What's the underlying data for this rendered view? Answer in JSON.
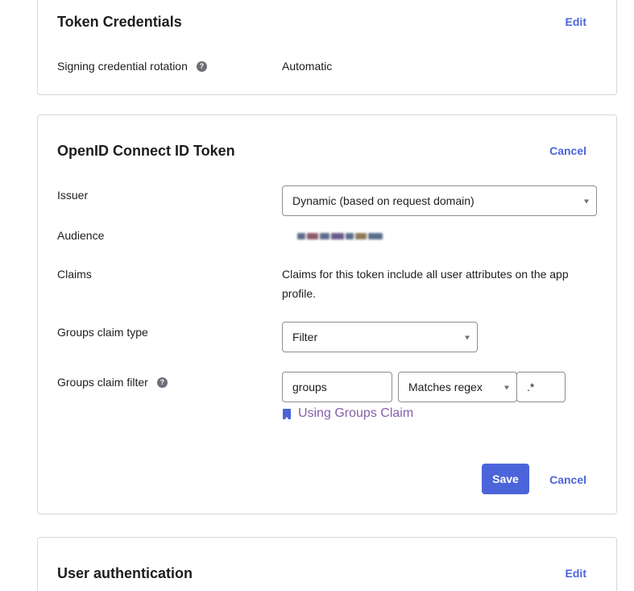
{
  "token_credentials": {
    "title": "Token Credentials",
    "edit_label": "Edit",
    "rotation_label": "Signing credential rotation",
    "rotation_value": "Automatic"
  },
  "oidc_token": {
    "title": "OpenID Connect ID Token",
    "cancel_label": "Cancel",
    "issuer_label": "Issuer",
    "issuer_value": "Dynamic (based on request domain)",
    "audience_label": "Audience",
    "claims_label": "Claims",
    "claims_line1": "Claims for this token include all user attributes on the app",
    "claims_line2": "profile.",
    "groups_claim_type_label": "Groups claim type",
    "groups_claim_type_value": "Filter",
    "groups_claim_filter_label": "Groups claim filter",
    "filter_name_value": "groups",
    "filter_operator_value": "Matches regex",
    "filter_pattern_value": ".*",
    "doc_link_label": "Using Groups Claim",
    "save_label": "Save",
    "footer_cancel_label": "Cancel"
  },
  "user_authentication": {
    "title": "User authentication",
    "edit_label": "Edit"
  },
  "colors": {
    "accent": "#4c64d9",
    "link_visited": "#8560a8",
    "border": "#d7d7dc"
  }
}
